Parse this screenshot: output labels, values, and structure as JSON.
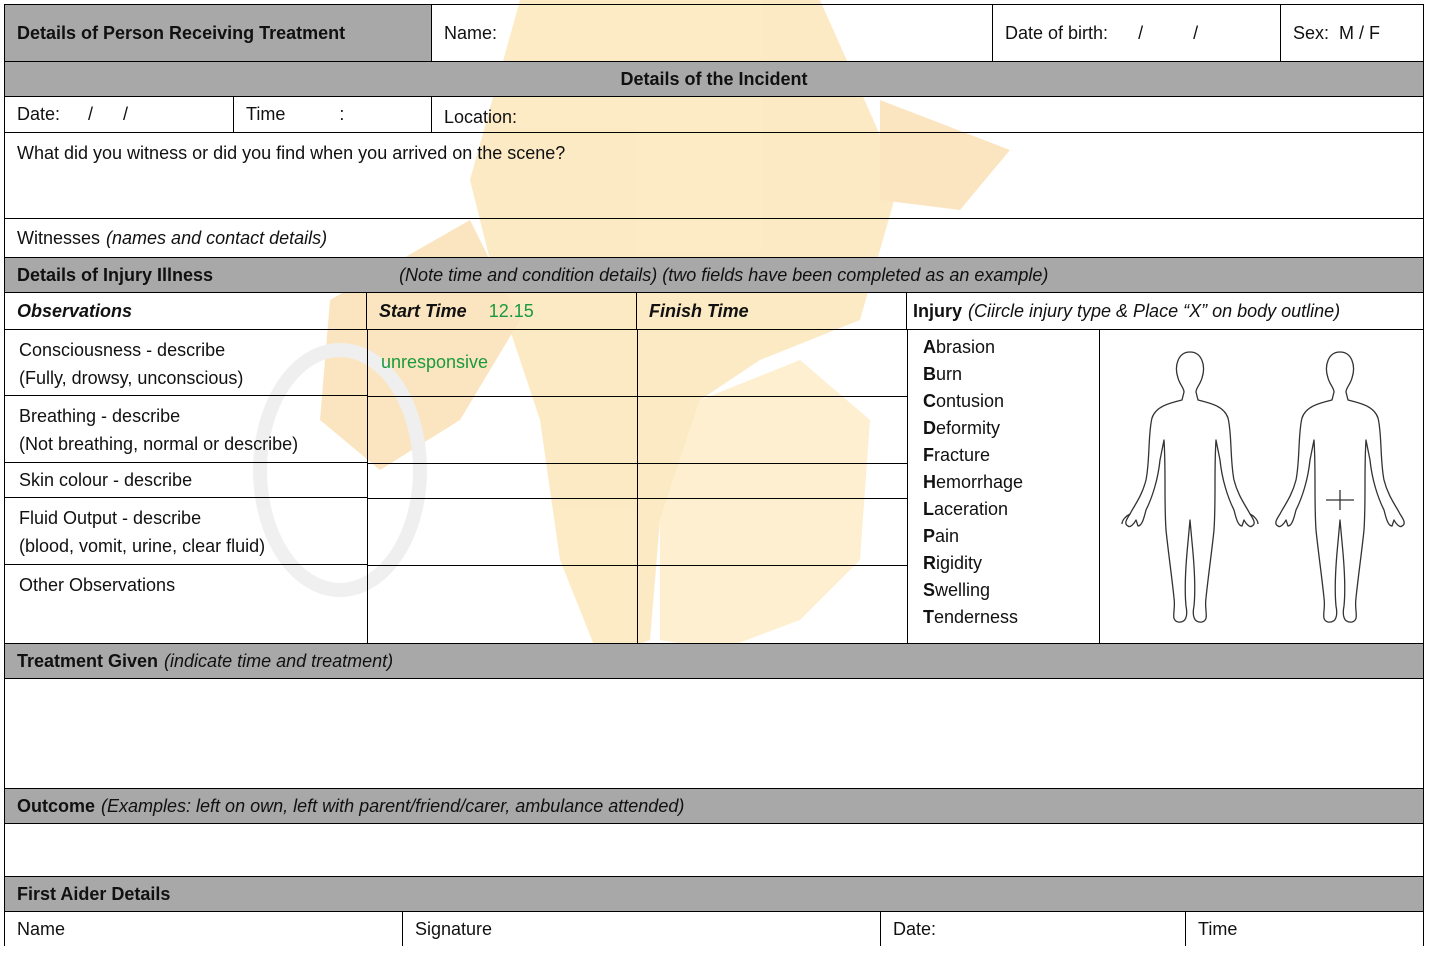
{
  "person": {
    "section_label": "Details of Person Receiving Treatment",
    "name_label": "Name:",
    "dob_label": "Date of birth:",
    "dob_slashes": "/          /",
    "sex_label": "Sex:  M / F"
  },
  "incident": {
    "header": "Details of the Incident",
    "date_label": "Date:",
    "date_slashes": "/      /",
    "time_label": "Time",
    "time_colon": ":",
    "location_label": "Location:",
    "witness_question": "What did you witness or did you find when you arrived on the scene?",
    "witnesses_label": "Witnesses",
    "witnesses_hint": "(names and contact details)"
  },
  "injury": {
    "header": "Details of Injury Illness",
    "header_note": "(Note time and condition details) (two fields have been completed as an example)",
    "col_observations": "Observations",
    "col_start_time": "Start Time",
    "start_time_example": "12.15",
    "col_finish_time": "Finish Time",
    "col_injury": "Injury",
    "col_injury_hint": "(Ciircle injury type & Place “X” on body outline)",
    "observations": [
      {
        "line1": "Consciousness - describe",
        "line2": "(Fully, drowsy, unconscious)",
        "start": "unresponsive",
        "finish": ""
      },
      {
        "line1": "Breathing - describe",
        "line2": "(Not breathing, normal or describe)",
        "start": "",
        "finish": ""
      },
      {
        "line1": "Skin colour - describe",
        "line2": "",
        "start": "",
        "finish": ""
      },
      {
        "line1": "Fluid Output - describe",
        "line2": "(blood, vomit, urine, clear fluid)",
        "start": "",
        "finish": ""
      },
      {
        "line1": "Other Observations",
        "line2": "",
        "start": "",
        "finish": ""
      }
    ],
    "injury_types": [
      {
        "initial": "A",
        "rest": "brasion"
      },
      {
        "initial": "B",
        "rest": "urn"
      },
      {
        "initial": "C",
        "rest": "ontusion"
      },
      {
        "initial": "D",
        "rest": "eformity"
      },
      {
        "initial": "F",
        "rest": "racture"
      },
      {
        "initial": "H",
        "rest": "emorrhage"
      },
      {
        "initial": "L",
        "rest": "aceration"
      },
      {
        "initial": "P",
        "rest": "ain"
      },
      {
        "initial": "R",
        "rest": "igidity"
      },
      {
        "initial": "S",
        "rest": "welling"
      },
      {
        "initial": "T",
        "rest": "enderness"
      }
    ]
  },
  "treatment": {
    "label": "Treatment Given",
    "hint": "(indicate time and treatment)"
  },
  "outcome": {
    "label": "Outcome",
    "hint": "(Examples: left on own, left with parent/friend/carer, ambulance attended)"
  },
  "first_aider": {
    "header": "First Aider Details",
    "name_label": "Name",
    "signature_label": "Signature",
    "date_label": "Date:",
    "time_label": "Time"
  },
  "colors": {
    "header_gray": "#a8a8a8",
    "example_green": "#1a9a3c",
    "watermark_orange": "#f7b733"
  }
}
